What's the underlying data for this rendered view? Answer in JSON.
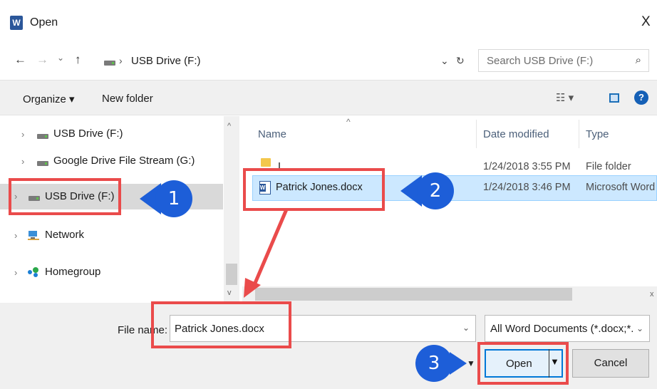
{
  "window": {
    "title": "Open",
    "close_label": "X"
  },
  "nav": {
    "back": "←",
    "forward": "→",
    "recent": "⌄",
    "up": "↑"
  },
  "address": {
    "separator": "›",
    "breadcrumb": "USB Drive (F:)",
    "dropdown": "⌄",
    "refresh": "↻"
  },
  "search": {
    "placeholder": "Search USB Drive (F:)",
    "icon": "⌕"
  },
  "toolbar": {
    "organize_label": "Organize ▾",
    "new_folder_label": "New folder",
    "view_icon": "☷ ▾",
    "help_label": "?"
  },
  "sidebar": {
    "items": [
      {
        "label": "USB Drive (F:)",
        "icon": "drive-icon",
        "chevron": "›"
      },
      {
        "label": "Google Drive File Stream (G:)",
        "icon": "drive-icon",
        "chevron": "›"
      },
      {
        "label": "USB Drive (F:)",
        "icon": "drive-icon",
        "chevron": "›",
        "selected": true
      },
      {
        "label": "Network",
        "icon": "network-icon",
        "chevron": "›"
      },
      {
        "label": "Homegroup",
        "icon": "homegroup-icon",
        "chevron": "›"
      }
    ],
    "scroll_up": "^",
    "scroll_down": "v"
  },
  "file_list": {
    "columns": [
      "Name",
      "Date modified",
      "Type"
    ],
    "sort_indicator": "^",
    "rows": [
      {
        "name": "I",
        "date": "1/24/2018 3:55 PM",
        "type": "File folder",
        "icon": "folder-icon"
      },
      {
        "name": "Patrick Jones.docx",
        "date": "1/24/2018 3:46 PM",
        "type": "Microsoft Word",
        "icon": "word-document-icon",
        "selected": true
      }
    ],
    "h_scroll_right": "x"
  },
  "footer": {
    "file_name_label": "File name:",
    "file_name_value": "Patrick Jones.docx",
    "file_name_dropdown": "⌄",
    "filter_label": "All Word Documents (*.docx;*.d",
    "filter_dropdown": "⌄",
    "open_label": "Open",
    "open_caret": "▼",
    "cancel_label": "Cancel",
    "dropdown_marker": "▼"
  },
  "callouts": {
    "one": "1",
    "two": "2",
    "three": "3"
  },
  "colors": {
    "highlight": "#ea4b4b",
    "callout": "#1d5ed8",
    "selection": "#cce8ff",
    "accent": "#0078d7"
  }
}
